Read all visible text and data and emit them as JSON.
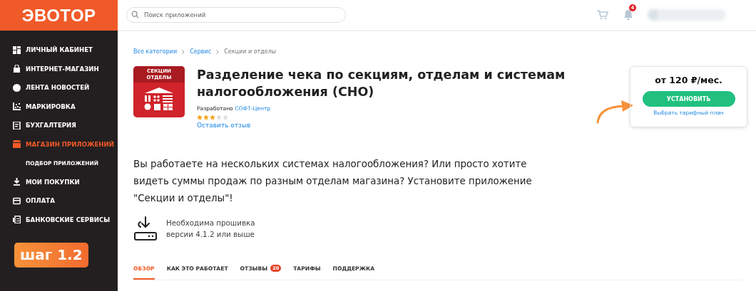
{
  "logo": "ЭВОТОР",
  "sidebar": {
    "items": [
      {
        "label": "ЛИЧНЫЙ КАБИНЕТ",
        "kind": "item",
        "selected": false
      },
      {
        "label": "ИНТЕРНЕТ-МАГАЗИН",
        "kind": "item",
        "selected": false
      },
      {
        "label": "ЛЕНТА НОВОСТЕЙ",
        "kind": "item",
        "selected": false
      },
      {
        "label": "МАРКИРОВКА",
        "kind": "item",
        "selected": false
      },
      {
        "label": "БУХГАЛТЕРИЯ",
        "kind": "item",
        "selected": false
      },
      {
        "label": "МАГАЗИН ПРИЛОЖЕНИЙ",
        "kind": "item",
        "selected": true
      },
      {
        "label": "ПОДБОР ПРИЛОЖЕНИЙ",
        "kind": "subitem",
        "selected": false
      },
      {
        "label": "МОИ ПОКУПКИ",
        "kind": "item",
        "selected": false
      },
      {
        "label": "ОПЛАТА",
        "kind": "item",
        "selected": false
      },
      {
        "label": "БАНКОВСКИЕ СЕРВИСЫ",
        "kind": "item",
        "selected": false
      }
    ],
    "step_badge": "шаг 1.2"
  },
  "search": {
    "placeholder": "Поиск приложений"
  },
  "notifications": {
    "count": "4"
  },
  "breadcrumbs": [
    {
      "label": "Все категории",
      "current": false
    },
    {
      "label": "Сервис",
      "current": false
    },
    {
      "label": "Секции и отделы",
      "current": true
    }
  ],
  "app": {
    "icon_caption": [
      "СЕКЦИИ",
      "ОТДЕЛЫ"
    ],
    "title": "Разделение чека по секциям, отделам и системам налогообложения (СНО)",
    "developer_label": "Разработано",
    "developer": "СОФТ-Центр",
    "stars": 3,
    "review_link": "Оставить отзыв"
  },
  "price_card": {
    "price": "от 120 ₽/мес.",
    "install_button": "УСТАНОВИТЬ",
    "plan_link": "Выбрать тарифный план"
  },
  "description": "Вы работаете на нескольких системах налогообложения? Или просто хотите видеть суммы продаж по разным отделам магазина? Установите приложение \"Секции и отделы\"!",
  "requirement": "Необходима прошивка версии 4.1.2 или выше",
  "tabs": [
    {
      "label": "ОБЗОР",
      "selected": true
    },
    {
      "label": "КАК ЭТО РАБОТАЕТ",
      "selected": false
    },
    {
      "label": "ОТЗЫВЫ",
      "selected": false,
      "badge": "20"
    },
    {
      "label": "ТАРИФЫ",
      "selected": false
    },
    {
      "label": "ПОДДЕРЖКА",
      "selected": false
    }
  ]
}
